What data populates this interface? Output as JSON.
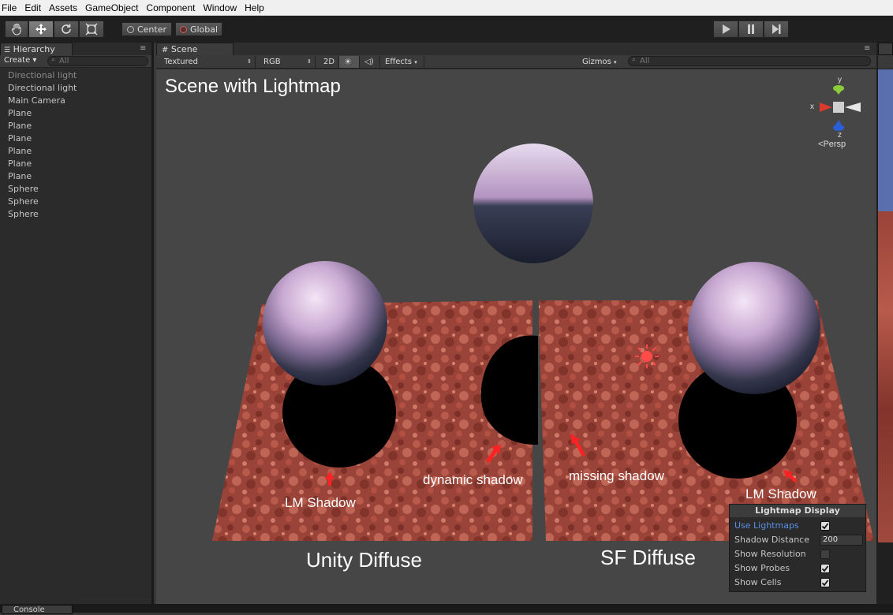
{
  "menu": [
    "File",
    "Edit",
    "Assets",
    "GameObject",
    "Component",
    "Window",
    "Help"
  ],
  "toolbar": {
    "center_label": "Center",
    "global_label": "Global"
  },
  "hierarchy": {
    "tab_label": "Hierarchy",
    "create_label": "Create ▾",
    "search_placeholder": "All",
    "items": [
      "Directional light",
      "Directional light",
      "Main Camera",
      "Plane",
      "Plane",
      "Plane",
      "Plane",
      "Plane",
      "Plane",
      "Sphere",
      "Sphere",
      "Sphere"
    ]
  },
  "scene": {
    "tab_label": "Scene",
    "shading_mode": "Textured",
    "render_mode": "RGB",
    "mode_2d": "2D",
    "effects_label": "Effects",
    "gizmos_label": "Gizmos",
    "search_placeholder": "All",
    "persp_label": "Persp",
    "axis_labels": {
      "y": "y",
      "x": "x",
      "z": "z"
    }
  },
  "viewport_labels": {
    "title": "Scene with Lightmap",
    "lm_shadow_left": "LM Shadow",
    "dynamic_shadow": "dynamic shadow",
    "missing_shadow": "missing shadow",
    "lm_shadow_right": "LM Shadow",
    "unity_diffuse": "Unity Diffuse",
    "sf_diffuse": "SF Diffuse"
  },
  "lightmap_display": {
    "title": "Lightmap Display",
    "use_lightmaps": "Use Lightmaps",
    "use_lightmaps_checked": true,
    "shadow_distance_label": "Shadow Distance",
    "shadow_distance_value": "200",
    "show_resolution": "Show Resolution",
    "show_resolution_checked": false,
    "show_probes": "Show Probes",
    "show_probes_checked": true,
    "show_cells": "Show Cells",
    "show_cells_checked": true
  },
  "bottom": {
    "console_label": "Console"
  },
  "colors": {
    "accent_blue": "#5a8fe6",
    "arrow_red": "#ff2222",
    "axis_x": "#d93a2b",
    "axis_y": "#8acc3a",
    "axis_z": "#2b5fd9"
  }
}
